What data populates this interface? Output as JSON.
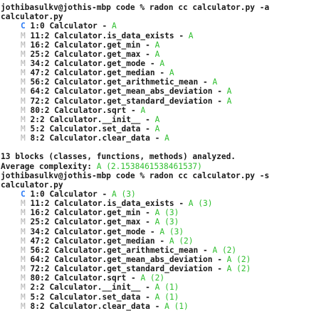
{
  "terminal": {
    "lines": [
      {
        "kind": "cmd",
        "text": "                                                          "
      },
      {
        "kind": "cmd",
        "text": "jothibasulkv@jothis-mbp code % radon cc calculator.py -a"
      },
      {
        "kind": "plain",
        "text": "calculator.py"
      },
      {
        "kind": "entry",
        "type": "C",
        "sig": "1:0 Calculator",
        "sep": " - ",
        "grade": "A"
      },
      {
        "kind": "entry",
        "type": "M",
        "sig": "11:2 Calculator.is_data_exists",
        "sep": " - ",
        "grade": "A"
      },
      {
        "kind": "entry",
        "type": "M",
        "sig": "16:2 Calculator.get_min",
        "sep": " - ",
        "grade": "A"
      },
      {
        "kind": "entry",
        "type": "M",
        "sig": "25:2 Calculator.get_max",
        "sep": " - ",
        "grade": "A"
      },
      {
        "kind": "entry",
        "type": "M",
        "sig": "34:2 Calculator.get_mode",
        "sep": " - ",
        "grade": "A"
      },
      {
        "kind": "entry",
        "type": "M",
        "sig": "47:2 Calculator.get_median",
        "sep": " - ",
        "grade": "A"
      },
      {
        "kind": "entry",
        "type": "M",
        "sig": "56:2 Calculator.get_arithmetic_mean",
        "sep": " - ",
        "grade": "A"
      },
      {
        "kind": "entry",
        "type": "M",
        "sig": "64:2 Calculator.get_mean_abs_deviation",
        "sep": " - ",
        "grade": "A"
      },
      {
        "kind": "entry",
        "type": "M",
        "sig": "72:2 Calculator.get_standard_deviation",
        "sep": " - ",
        "grade": "A"
      },
      {
        "kind": "entry",
        "type": "M",
        "sig": "80:2 Calculator.sqrt",
        "sep": " - ",
        "grade": "A"
      },
      {
        "kind": "entry",
        "type": "M",
        "sig": "2:2 Calculator.__init__",
        "sep": " - ",
        "grade": "A"
      },
      {
        "kind": "entry",
        "type": "M",
        "sig": "5:2 Calculator.set_data",
        "sep": " - ",
        "grade": "A"
      },
      {
        "kind": "entry",
        "type": "M",
        "sig": "8:2 Calculator.clear_data",
        "sep": " - ",
        "grade": "A"
      },
      {
        "kind": "blank",
        "text": ""
      },
      {
        "kind": "plain",
        "text": "13 blocks (classes, functions, methods) analyzed."
      },
      {
        "kind": "avg",
        "label": "Average complexity: ",
        "value": "A (2.1538461538461537)"
      },
      {
        "kind": "cmd",
        "text": "jothibasulkv@jothis-mbp code % radon cc calculator.py -s"
      },
      {
        "kind": "plain",
        "text": "calculator.py"
      },
      {
        "kind": "entry",
        "type": "C",
        "sig": "1:0 Calculator",
        "sep": " - ",
        "grade": "A (3)"
      },
      {
        "kind": "entry",
        "type": "M",
        "sig": "11:2 Calculator.is_data_exists",
        "sep": " - ",
        "grade": "A (3)"
      },
      {
        "kind": "entry",
        "type": "M",
        "sig": "16:2 Calculator.get_min",
        "sep": " - ",
        "grade": "A (3)"
      },
      {
        "kind": "entry",
        "type": "M",
        "sig": "25:2 Calculator.get_max",
        "sep": " - ",
        "grade": "A (3)"
      },
      {
        "kind": "entry",
        "type": "M",
        "sig": "34:2 Calculator.get_mode",
        "sep": " - ",
        "grade": "A (3)"
      },
      {
        "kind": "entry",
        "type": "M",
        "sig": "47:2 Calculator.get_median",
        "sep": " - ",
        "grade": "A (2)"
      },
      {
        "kind": "entry",
        "type": "M",
        "sig": "56:2 Calculator.get_arithmetic_mean",
        "sep": " - ",
        "grade": "A (2)"
      },
      {
        "kind": "entry",
        "type": "M",
        "sig": "64:2 Calculator.get_mean_abs_deviation",
        "sep": " - ",
        "grade": "A (2)"
      },
      {
        "kind": "entry",
        "type": "M",
        "sig": "72:2 Calculator.get_standard_deviation",
        "sep": " - ",
        "grade": "A (2)"
      },
      {
        "kind": "entry",
        "type": "M",
        "sig": "80:2 Calculator.sqrt",
        "sep": " - ",
        "grade": "A (2)"
      },
      {
        "kind": "entry",
        "type": "M",
        "sig": "2:2 Calculator.__init__",
        "sep": " - ",
        "grade": "A (1)"
      },
      {
        "kind": "entry",
        "type": "M",
        "sig": "5:2 Calculator.set_data",
        "sep": " - ",
        "grade": "A (1)"
      },
      {
        "kind": "entry",
        "type": "M",
        "sig": "8:2 Calculator.clear_data",
        "sep": " - ",
        "grade": "A (1)"
      }
    ]
  },
  "colors": {
    "foreground": "#1a1a1a",
    "class_marker": "#2f7df6",
    "method_marker": "#b0b0b0",
    "grade": "#2fbf2f",
    "background": "#ffffff"
  }
}
